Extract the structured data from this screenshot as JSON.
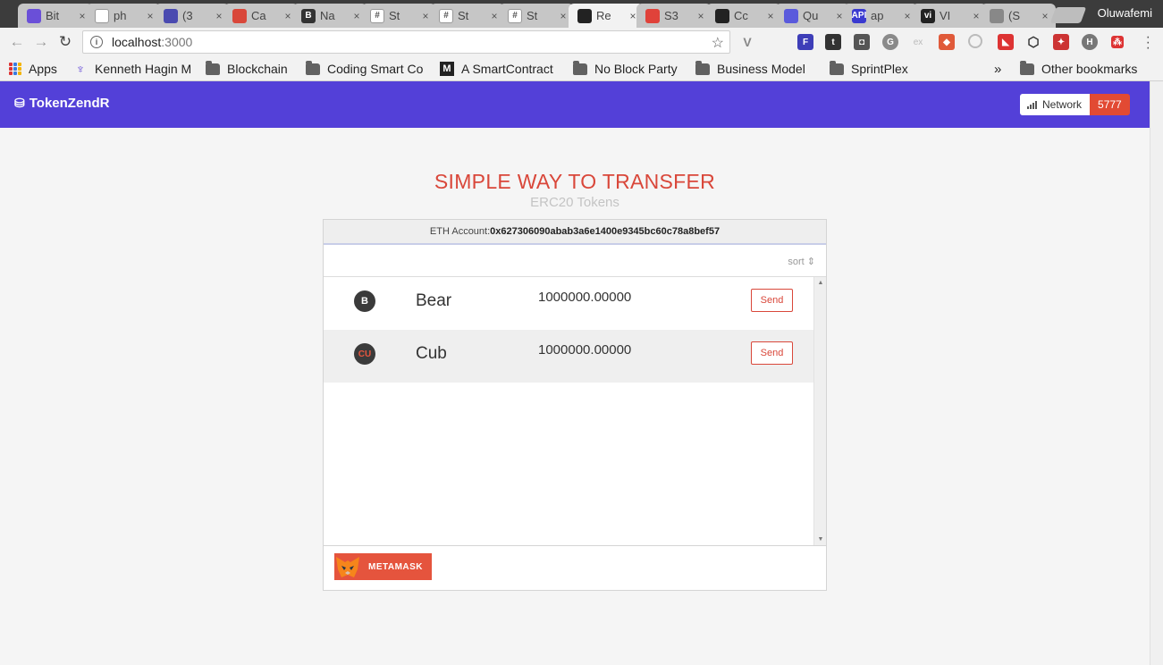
{
  "browser": {
    "tabs": [
      {
        "title": "Bit",
        "color": "#6a4fd8",
        "glyph": "",
        "active": false
      },
      {
        "title": "ph",
        "color": "#ffffff",
        "glyph": "",
        "active": false
      },
      {
        "title": "(3",
        "color": "#4a4ab0",
        "glyph": "",
        "active": false
      },
      {
        "title": "Ca",
        "color": "#d9473a",
        "glyph": "",
        "active": false
      },
      {
        "title": "Na",
        "color": "#333333",
        "glyph": "B",
        "active": false
      },
      {
        "title": "St",
        "color": "#ffffff",
        "glyph": "#",
        "active": false
      },
      {
        "title": "St",
        "color": "#ffffff",
        "glyph": "#",
        "active": false
      },
      {
        "title": "St",
        "color": "#ffffff",
        "glyph": "#",
        "active": false
      },
      {
        "title": "Re",
        "color": "#222222",
        "glyph": "",
        "active": true
      },
      {
        "title": "S3",
        "color": "#e0423a",
        "glyph": "",
        "active": false
      },
      {
        "title": "Cc",
        "color": "#222222",
        "glyph": "",
        "active": false
      },
      {
        "title": "Qu",
        "color": "#5a5adc",
        "glyph": "",
        "active": false
      },
      {
        "title": "ap",
        "color": "#3a3ad0",
        "glyph": "API",
        "active": false
      },
      {
        "title": "VI",
        "color": "#222222",
        "glyph": "vi",
        "active": false
      },
      {
        "title": "(S",
        "color": "#888888",
        "glyph": "",
        "active": false
      }
    ],
    "tab_close": "×",
    "profile_name": "Oluwafemi",
    "url_host": "localhost",
    "url_port": ":3000",
    "bookmarks": [
      {
        "label": "Apps",
        "type": "apps"
      },
      {
        "label": "Kenneth Hagin M",
        "type": "site"
      },
      {
        "label": "Blockchain",
        "type": "folder"
      },
      {
        "label": "Coding Smart Co",
        "type": "folder"
      },
      {
        "label": "A SmartContract",
        "type": "medium"
      },
      {
        "label": "No Block Party",
        "type": "folder"
      },
      {
        "label": "Business Model",
        "type": "folder"
      },
      {
        "label": "SprintPlex",
        "type": "folder"
      }
    ],
    "bookmarks_overflow": "»",
    "other_bookmarks": "Other bookmarks"
  },
  "app": {
    "brand": "TokenZendR",
    "network_label": "Network",
    "network_id": "5777",
    "title": "SIMPLE WAY TO TRANSFER",
    "subtitle": "ERC20 Tokens",
    "account_label": "ETH Account:",
    "account_address": "0x627306090abab3a6e1400e9345bc60c78a8bef57",
    "sort_label": "sort",
    "send_label": "Send",
    "tokens": [
      {
        "symbol": "B",
        "name": "Bear",
        "balance": "1000000.00000"
      },
      {
        "symbol": "CU",
        "name": "Cub",
        "balance": "1000000.00000"
      }
    ],
    "metamask_label": "METAMASK"
  },
  "colors": {
    "header": "#5340d8",
    "accent": "#d9473a",
    "network_badge": "#e24a33"
  }
}
